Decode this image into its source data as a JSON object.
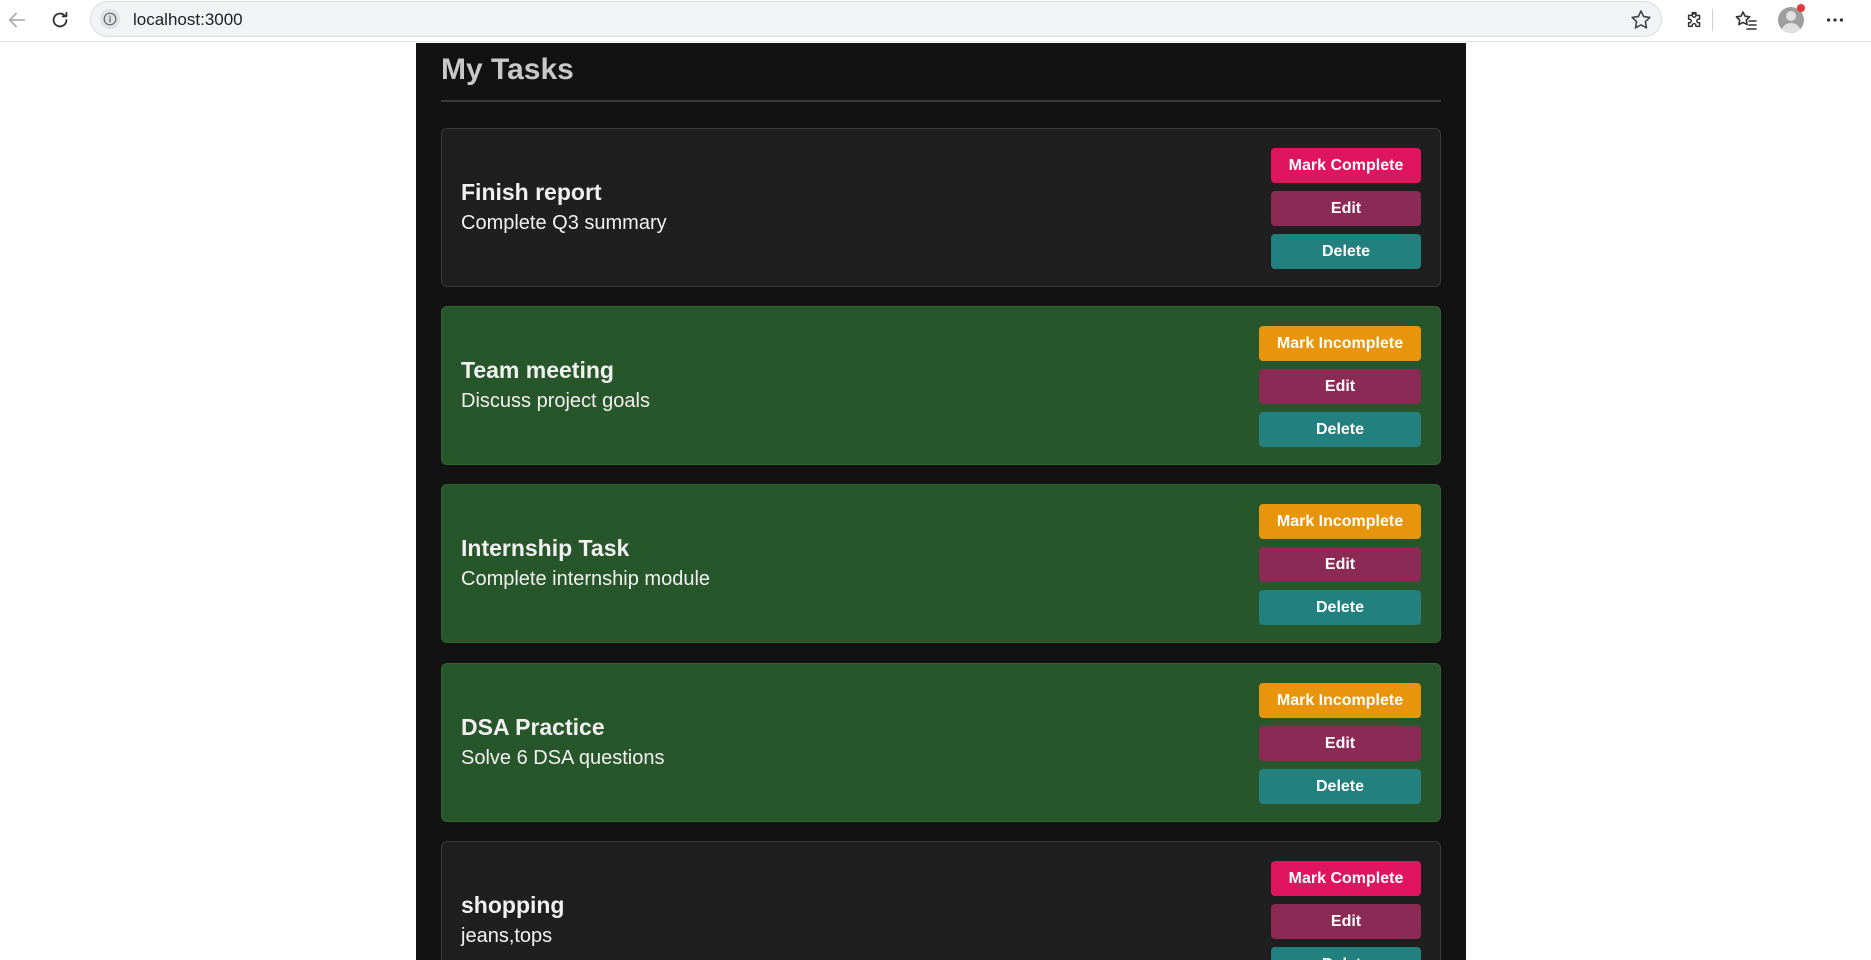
{
  "browser": {
    "url": "localhost:3000"
  },
  "app": {
    "title": "My Tasks"
  },
  "colors": {
    "app_background": "#121212",
    "card_pending": "#1f1f1f",
    "card_completed": "#28562b",
    "mark_complete": "#e0155f",
    "mark_incomplete": "#e8950b",
    "edit": "#8b2a54",
    "delete": "#22807e"
  },
  "tasks": [
    {
      "title": "Finish report",
      "description": "Complete Q3 summary",
      "completed": false,
      "toggle_label": "Mark Complete",
      "edit_label": "Edit",
      "delete_label": "Delete"
    },
    {
      "title": "Team meeting",
      "description": "Discuss project goals",
      "completed": true,
      "toggle_label": "Mark Incomplete",
      "edit_label": "Edit",
      "delete_label": "Delete"
    },
    {
      "title": "Internship Task",
      "description": "Complete internship module",
      "completed": true,
      "toggle_label": "Mark Incomplete",
      "edit_label": "Edit",
      "delete_label": "Delete"
    },
    {
      "title": "DSA Practice",
      "description": "Solve 6 DSA questions",
      "completed": true,
      "toggle_label": "Mark Incomplete",
      "edit_label": "Edit",
      "delete_label": "Delete"
    },
    {
      "title": "shopping",
      "description": "jeans,tops",
      "completed": false,
      "toggle_label": "Mark Complete",
      "edit_label": "Edit",
      "delete_label": "Delete"
    }
  ]
}
